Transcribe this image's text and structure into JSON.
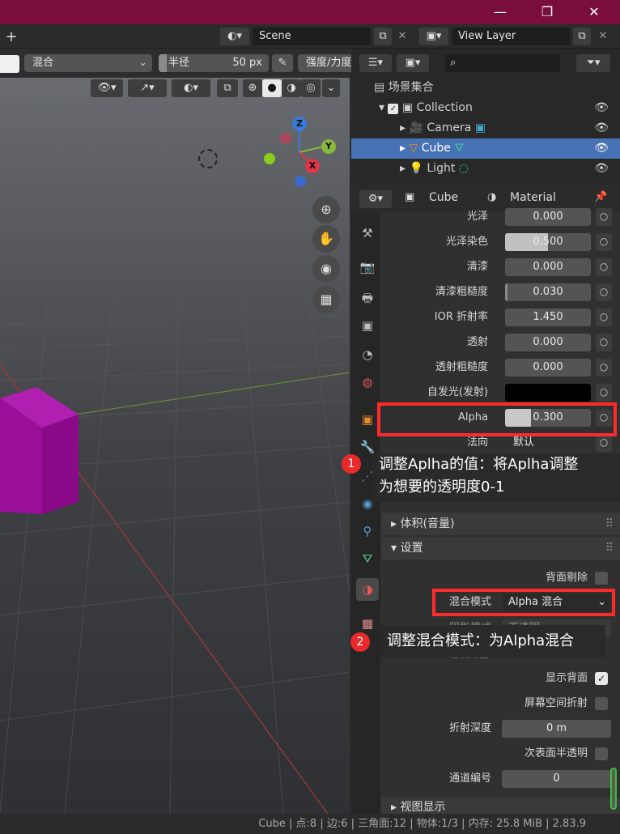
{
  "window_controls": {
    "minimize": "—",
    "maximize": "❐",
    "close": "✕"
  },
  "topbar": {
    "add": "+",
    "scene": "Scene",
    "view_layer": "View Layer"
  },
  "brush": {
    "blend": "混合",
    "radius_label": "半径",
    "radius_value": "50 px",
    "strength_label": "强度/力度"
  },
  "outliner": {
    "search_placeholder": "",
    "scene_collection": "场景集合",
    "items": [
      {
        "label": "Collection"
      },
      {
        "label": "Camera"
      },
      {
        "label": "Cube"
      },
      {
        "label": "Light"
      }
    ]
  },
  "props_header": {
    "object": "Cube",
    "material": "Material"
  },
  "properties": [
    {
      "label": "光泽",
      "value": "0.000",
      "fill": 0
    },
    {
      "label": "光泽染色",
      "value": "0.500",
      "fill": 0.5
    },
    {
      "label": "清漆",
      "value": "0.000",
      "fill": 0
    },
    {
      "label": "清漆粗糙度",
      "value": "0.030",
      "fill": 0.03
    },
    {
      "label": "IOR 折射率",
      "value": "1.450",
      "fill": 0
    },
    {
      "label": "透射",
      "value": "0.000",
      "fill": 0
    },
    {
      "label": "透射粗糙度",
      "value": "0.000",
      "fill": 0
    },
    {
      "label": "自发光(发射)",
      "value": "",
      "fill": 0
    },
    {
      "label": "Alpha",
      "value": "0.300",
      "fill": 0.3
    },
    {
      "label": "法向",
      "value": "默认",
      "fill": 0
    },
    {
      "label": "",
      "value": "默认",
      "fill": 0
    }
  ],
  "sections": {
    "volume": "体积(音量)",
    "settings": "设置",
    "viewport_display": "视图显示"
  },
  "settings": {
    "backface_culling": "背面剔除",
    "blend_mode_label": "混合模式",
    "blend_mode_value": "Alpha 混合",
    "shadow_mode_label": "阴影模式",
    "shadow_mode_value": "不透明",
    "clip_threshold_label": "钳制阈值",
    "show_backface": "显示背面",
    "screen_refraction": "屏幕空间折射",
    "refraction_depth_label": "折射深度",
    "refraction_depth_value": "0 m",
    "sss_translucency": "次表面半透明",
    "pass_index_label": "通道编号",
    "pass_index_value": "0"
  },
  "annotations": {
    "note1_num": "1",
    "note1_line1": "调整Aplha的值：将Aplha调整",
    "note1_line2": "为想要的透明度0-1",
    "note2_num": "2",
    "note2_text": "调整混合模式：为Alpha混合"
  },
  "gizmo": {
    "z": "Z",
    "y": "Y",
    "x": "X"
  },
  "status_bar": "Cube | 点:8 | 边:6 | 三角面:12 | 物体:1/3 | 内存: 25.8 MiB | 2.83.9",
  "colors": {
    "titlebar": "#7a0e3a",
    "selection": "#4772b3",
    "annotation": "#ff2b2b",
    "cube": "#9a0f9a"
  }
}
